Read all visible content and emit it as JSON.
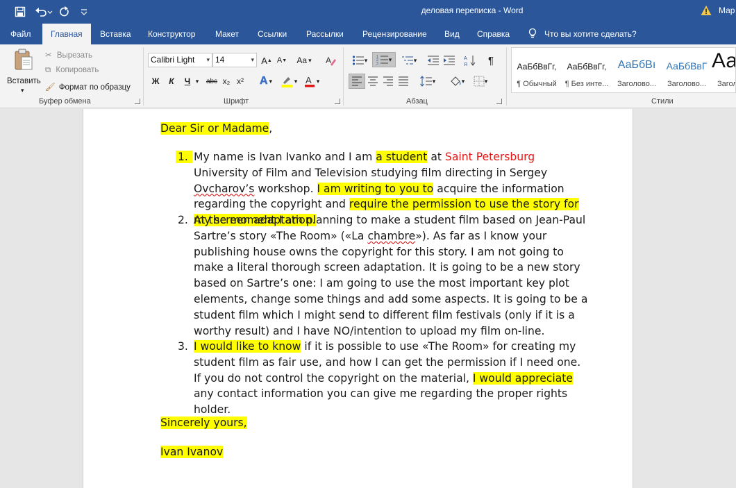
{
  "titlebar": {
    "title": "деловая переписка  -  Word",
    "user": "Мар"
  },
  "tabs": [
    {
      "label": "Файл"
    },
    {
      "label": "Главная"
    },
    {
      "label": "Вставка"
    },
    {
      "label": "Конструктор"
    },
    {
      "label": "Макет"
    },
    {
      "label": "Ссылки"
    },
    {
      "label": "Рассылки"
    },
    {
      "label": "Рецензирование"
    },
    {
      "label": "Вид"
    },
    {
      "label": "Справка"
    }
  ],
  "tell_me": "Что вы хотите сделать?",
  "clipboard": {
    "paste": "Вставить",
    "cut": "Вырезать",
    "copy": "Копировать",
    "format_painter": "Формат по образцу",
    "label": "Буфер обмена"
  },
  "font": {
    "family": "Calibri Light",
    "size": "14",
    "label": "Шрифт",
    "case_glyph": "Aa",
    "bold": "Ж",
    "italic": "К",
    "underline": "Ч",
    "strike": "abc",
    "subscript": "x₂",
    "superscript": "x²",
    "font_color": "#e21818",
    "highlight_color": "#ffff00"
  },
  "paragraph": {
    "label": "Абзац",
    "pilcrow": "¶"
  },
  "styles": {
    "label": "Стили",
    "items": [
      {
        "sample": "АаБбВвГг,",
        "name": "¶ Обычный"
      },
      {
        "sample": "АаБбВвГг,",
        "name": "¶ Без инте..."
      },
      {
        "sample": "АаБбВı",
        "name": "Заголово..."
      },
      {
        "sample": "АаБбВвГ",
        "name": "Заголово..."
      },
      {
        "sample": "Аа",
        "name": "Загол"
      }
    ]
  },
  "document": {
    "greeting": "Dear Sir or Madame",
    "greeting_comma": ",",
    "p1_num": "1.",
    "p1_a": "My name is Ivan Ivanko and I am ",
    "p1_hl1": "a student",
    "p1_b": " at ",
    "p1_red": "Saint Petersburg",
    "p1_c": " University of Film and Television studying film directing in Sergey ",
    "p1_squig": "Ovcharov’s",
    "p1_d": " workshop. ",
    "p1_hl2": "I am writing to you to",
    "p1_e": " acquire the information regarding the copyright and ",
    "p1_hl3": "require the permission to use the story for my screen adaptation.",
    "p2_num": "2.",
    "p2_a": "At the moment I am planning to make a student film based on Jean-Paul Sartre’s story «The Room» («La ",
    "p2_squig": "chambre",
    "p2_b": "»). As far as I know your publishing house owns the copyright for this story. I am not going to make a literal thorough screen adaptation. It is going to be a new story based on Sartre’s one: I am going to use the most important key plot elements, change some things and add some aspects. It is going to be a student film which I might send to different film festivals (only if it is a worthy result) and I have NO/intention to upload my film on-line.",
    "p3_num": "3.",
    "p3_hl1": "I would like to know",
    "p3_a": " if it is possible to use «The Room» for creating my student film as fair use, and how I can get the permission if I need one. If you do not control the copyright on the material, ",
    "p3_hl2": "I would appreciate",
    "p3_b": " any contact information you can give me regarding the proper rights holder.",
    "closing": "Sincerely yours,",
    "signature": "Ivan Ivanov"
  }
}
